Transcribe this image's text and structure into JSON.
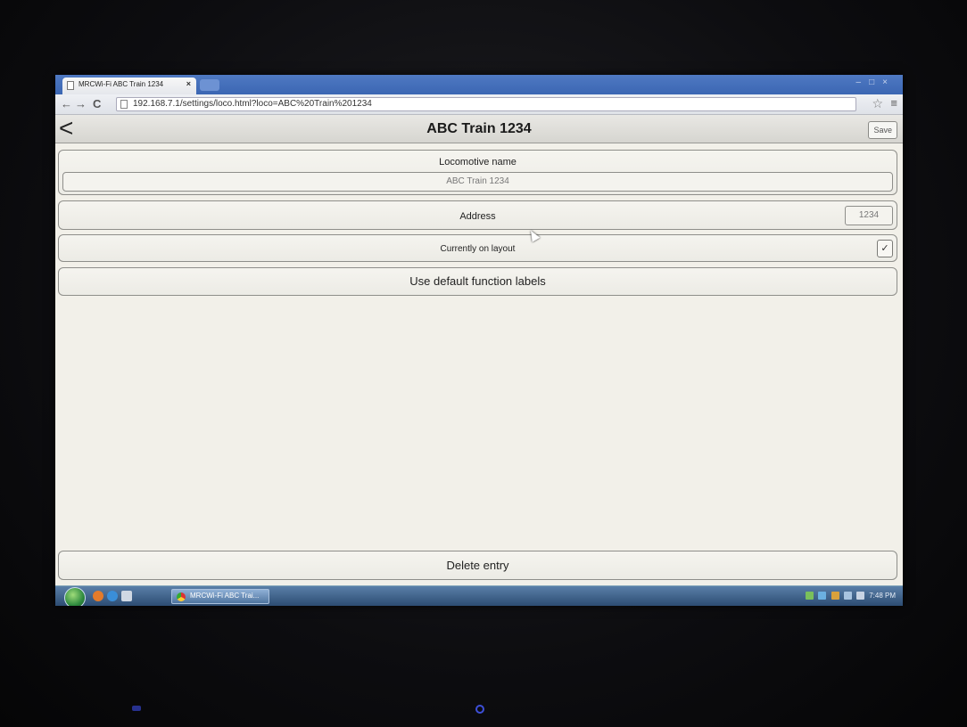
{
  "browser": {
    "tab_title": "MRCWi-Fi ABC Train 1234",
    "url": "192.168.7.1/settings/loco.html?loco=ABC%20Train%201234"
  },
  "header": {
    "title": "ABC Train 1234",
    "save_label": "Save"
  },
  "form": {
    "name_label": "Locomotive name",
    "name_value": "ABC Train 1234",
    "address_label": "Address",
    "address_value": "1234",
    "on_layout_label": "Currently on layout",
    "on_layout_checked": true,
    "check_glyph": "✓",
    "default_labels_button": "Use default function labels",
    "delete_button": "Delete entry"
  },
  "taskbar": {
    "task_label": "MRCWi-Fi ABC Trai...",
    "clock": "7:48 PM"
  }
}
